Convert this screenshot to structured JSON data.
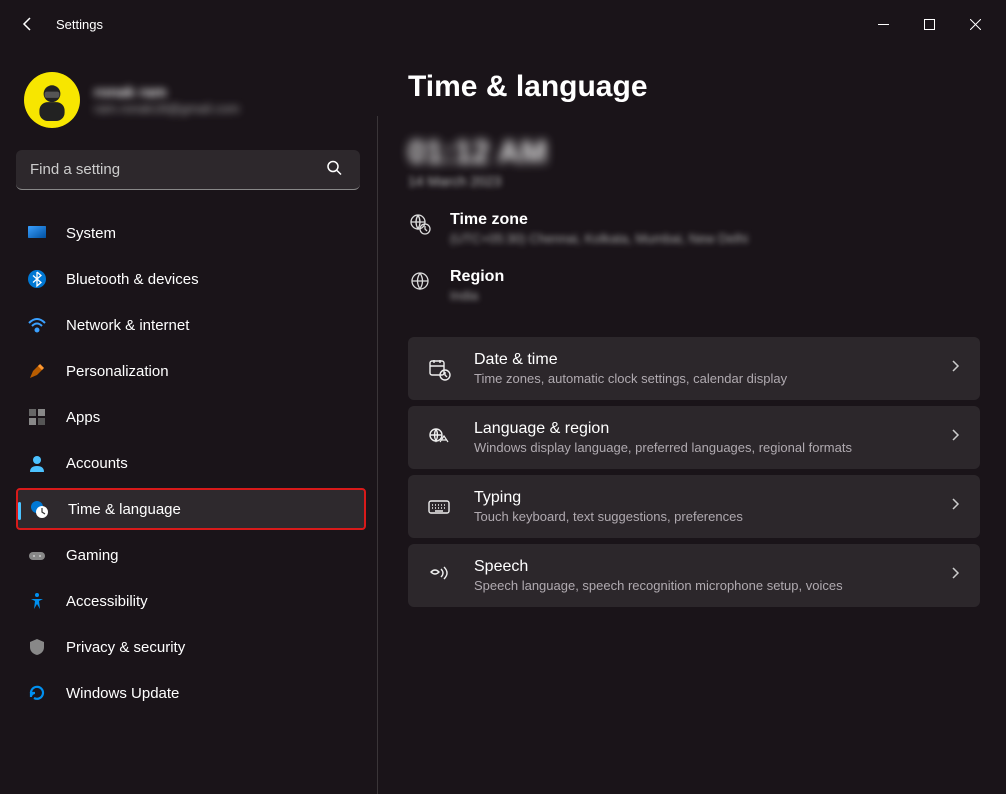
{
  "app": {
    "title": "Settings"
  },
  "profile": {
    "name": "ronak ram",
    "email": "ram.ronak18@gmail.com"
  },
  "search": {
    "placeholder": "Find a setting"
  },
  "sidebar": {
    "items": [
      {
        "label": "System"
      },
      {
        "label": "Bluetooth & devices"
      },
      {
        "label": "Network & internet"
      },
      {
        "label": "Personalization"
      },
      {
        "label": "Apps"
      },
      {
        "label": "Accounts"
      },
      {
        "label": "Time & language"
      },
      {
        "label": "Gaming"
      },
      {
        "label": "Accessibility"
      },
      {
        "label": "Privacy & security"
      },
      {
        "label": "Windows Update"
      }
    ]
  },
  "page": {
    "title": "Time & language",
    "clock": "01:12 AM",
    "date": "14 March 2023",
    "timezone": {
      "title": "Time zone",
      "value": "(UTC+05:30) Chennai, Kolkata, Mumbai, New Delhi"
    },
    "region": {
      "title": "Region",
      "value": "India"
    },
    "cards": [
      {
        "title": "Date & time",
        "sub": "Time zones, automatic clock settings, calendar display"
      },
      {
        "title": "Language & region",
        "sub": "Windows display language, preferred languages, regional formats"
      },
      {
        "title": "Typing",
        "sub": "Touch keyboard, text suggestions, preferences"
      },
      {
        "title": "Speech",
        "sub": "Speech language, speech recognition microphone setup, voices"
      }
    ]
  }
}
